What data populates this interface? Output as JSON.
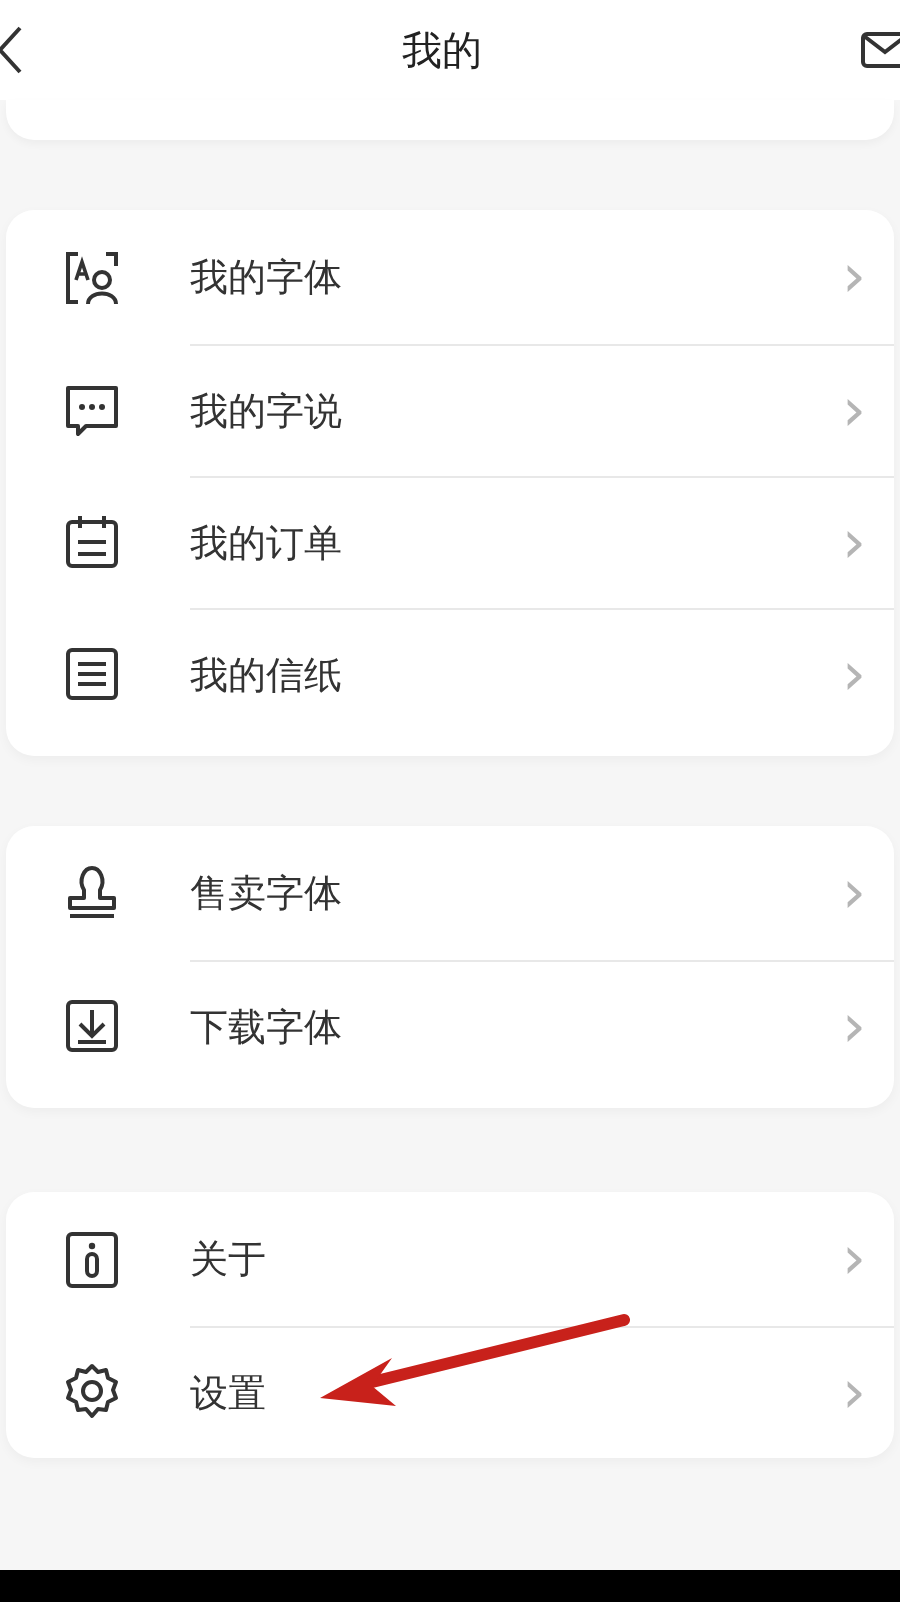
{
  "header": {
    "title": "我的"
  },
  "groups": [
    {
      "items": [
        {
          "kind": "font",
          "label": "我的字体",
          "chevron": "›"
        },
        {
          "kind": "chat",
          "label": "我的字说",
          "chevron": "›"
        },
        {
          "kind": "calendar",
          "label": "我的订单",
          "chevron": "›"
        },
        {
          "kind": "note",
          "label": "我的信纸",
          "chevron": "›"
        }
      ]
    },
    {
      "items": [
        {
          "kind": "stamp",
          "label": "售卖字体",
          "chevron": "›"
        },
        {
          "kind": "download",
          "label": "下载字体",
          "chevron": "›"
        }
      ]
    },
    {
      "items": [
        {
          "kind": "info",
          "label": "关于",
          "chevron": "›"
        },
        {
          "kind": "gear",
          "label": "设置",
          "chevron": "›"
        }
      ]
    }
  ],
  "annotation": {
    "kind": "arrow",
    "color": "#c8211b"
  }
}
